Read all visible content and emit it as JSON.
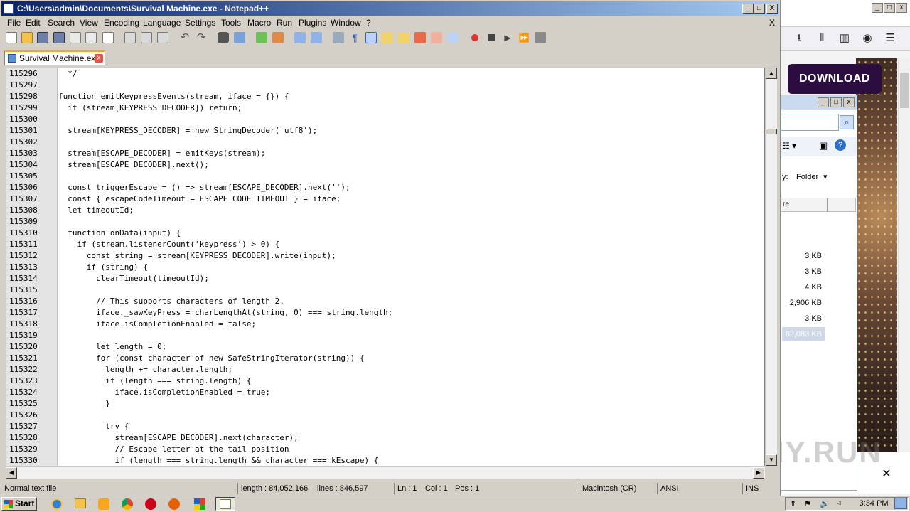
{
  "window": {
    "title": "C:\\Users\\admin\\Documents\\Survival Machine.exe - Notepad++",
    "minimize": "_",
    "maximize": "□",
    "close": "X"
  },
  "menu": [
    "File",
    "Edit",
    "Search",
    "View",
    "Encoding",
    "Language",
    "Settings",
    "Tools",
    "Macro",
    "Run",
    "Plugins",
    "Window",
    "?"
  ],
  "menu_close": "X",
  "tab": {
    "label": "Survival Machine.exe",
    "close": "x"
  },
  "editor": {
    "lines": [
      {
        "n": "115296",
        "t": "  */"
      },
      {
        "n": "115297",
        "t": ""
      },
      {
        "n": "115298",
        "t": "function emitKeypressEvents(stream, iface = {}) {"
      },
      {
        "n": "115299",
        "t": "  if (stream[KEYPRESS_DECODER]) return;"
      },
      {
        "n": "115300",
        "t": ""
      },
      {
        "n": "115301",
        "t": "  stream[KEYPRESS_DECODER] = new StringDecoder('utf8');"
      },
      {
        "n": "115302",
        "t": ""
      },
      {
        "n": "115303",
        "t": "  stream[ESCAPE_DECODER] = emitKeys(stream);"
      },
      {
        "n": "115304",
        "t": "  stream[ESCAPE_DECODER].next();"
      },
      {
        "n": "115305",
        "t": ""
      },
      {
        "n": "115306",
        "t": "  const triggerEscape = () => stream[ESCAPE_DECODER].next('');"
      },
      {
        "n": "115307",
        "t": "  const { escapeCodeTimeout = ESCAPE_CODE_TIMEOUT } = iface;"
      },
      {
        "n": "115308",
        "t": "  let timeoutId;"
      },
      {
        "n": "115309",
        "t": ""
      },
      {
        "n": "115310",
        "t": "  function onData(input) {"
      },
      {
        "n": "115311",
        "t": "    if (stream.listenerCount('keypress') > 0) {"
      },
      {
        "n": "115312",
        "t": "      const string = stream[KEYPRESS_DECODER].write(input);"
      },
      {
        "n": "115313",
        "t": "      if (string) {"
      },
      {
        "n": "115314",
        "t": "        clearTimeout(timeoutId);"
      },
      {
        "n": "115315",
        "t": ""
      },
      {
        "n": "115316",
        "t": "        // This supports characters of length 2."
      },
      {
        "n": "115317",
        "t": "        iface._sawKeyPress = charLengthAt(string, 0) === string.length;"
      },
      {
        "n": "115318",
        "t": "        iface.isCompletionEnabled = false;"
      },
      {
        "n": "115319",
        "t": ""
      },
      {
        "n": "115320",
        "t": "        let length = 0;"
      },
      {
        "n": "115321",
        "t": "        for (const character of new SafeStringIterator(string)) {"
      },
      {
        "n": "115322",
        "t": "          length += character.length;"
      },
      {
        "n": "115323",
        "t": "          if (length === string.length) {"
      },
      {
        "n": "115324",
        "t": "            iface.isCompletionEnabled = true;"
      },
      {
        "n": "115325",
        "t": "          }"
      },
      {
        "n": "115326",
        "t": ""
      },
      {
        "n": "115327",
        "t": "          try {"
      },
      {
        "n": "115328",
        "t": "            stream[ESCAPE_DECODER].next(character);"
      },
      {
        "n": "115329",
        "t": "            // Escape letter at the tail position"
      },
      {
        "n": "115330",
        "t": "            if (length === string.length && character === kEscape) {"
      }
    ]
  },
  "status": {
    "type": "Normal text file",
    "length": "length : 84,052,166",
    "lines": "lines : 846,597",
    "ln": "Ln : 1",
    "col": "Col : 1",
    "pos": "Pos : 1",
    "eol": "Macintosh (CR)",
    "encoding": "ANSI",
    "mode": "INS"
  },
  "background": {
    "download_label": "DOWNLOAD",
    "explorer_sort_label": "y:",
    "explorer_sort_value": "Folder",
    "explorer_column": "re",
    "file_sizes": [
      "3 KB",
      "3 KB",
      "4 KB",
      "2,906 KB",
      "3 KB",
      "82,083 KB"
    ],
    "close_x": "✕",
    "watermark": "ANY.RUN"
  },
  "taskbar": {
    "start_label": "Start",
    "clock": "3:34 PM"
  },
  "colors": {
    "titlebar_start": "#0a246a",
    "titlebar_end": "#a6caf0",
    "tab_accent": "#f5a623",
    "download_bg": "#2b0e3f"
  }
}
